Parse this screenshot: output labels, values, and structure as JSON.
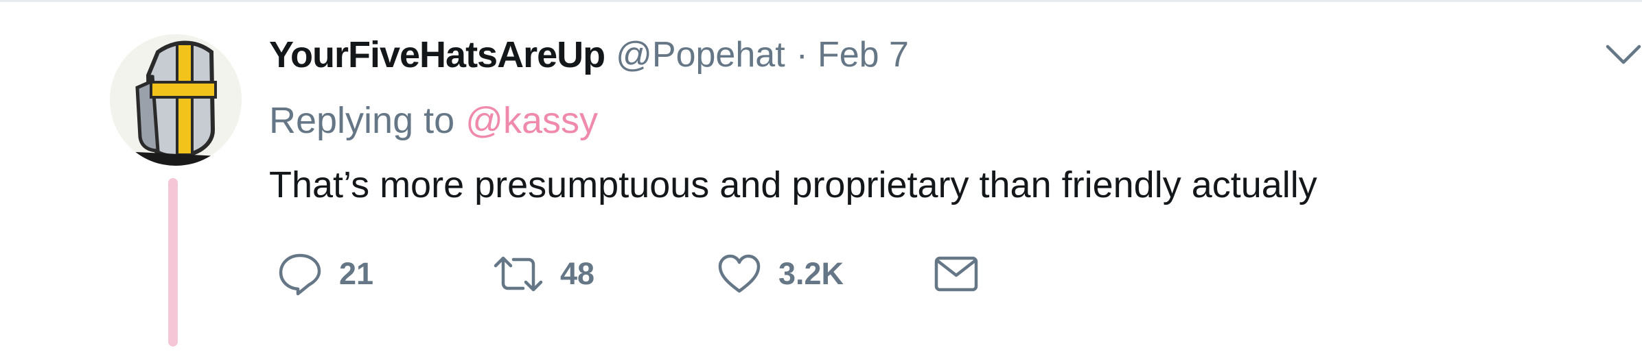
{
  "tweet": {
    "display_name": "YourFiveHatsAreUp",
    "handle": "@Popehat",
    "separator": "·",
    "date": "Feb 7",
    "replying_prefix": "Replying to",
    "replying_to": "@kassy",
    "text": "That’s more presumptuous and proprietary than friendly actually"
  },
  "actions": {
    "reply_count": "21",
    "retweet_count": "48",
    "like_count": "3.2K"
  },
  "icons": {
    "reply": "speech-bubble-icon",
    "retweet": "retweet-arrows-icon",
    "like": "heart-icon",
    "message": "envelope-icon",
    "menu": "chevron-down-icon"
  },
  "colors": {
    "name": "#14171a",
    "secondary": "#657786",
    "mention": "#f08aac",
    "thread_line": "#f5c6d6"
  }
}
